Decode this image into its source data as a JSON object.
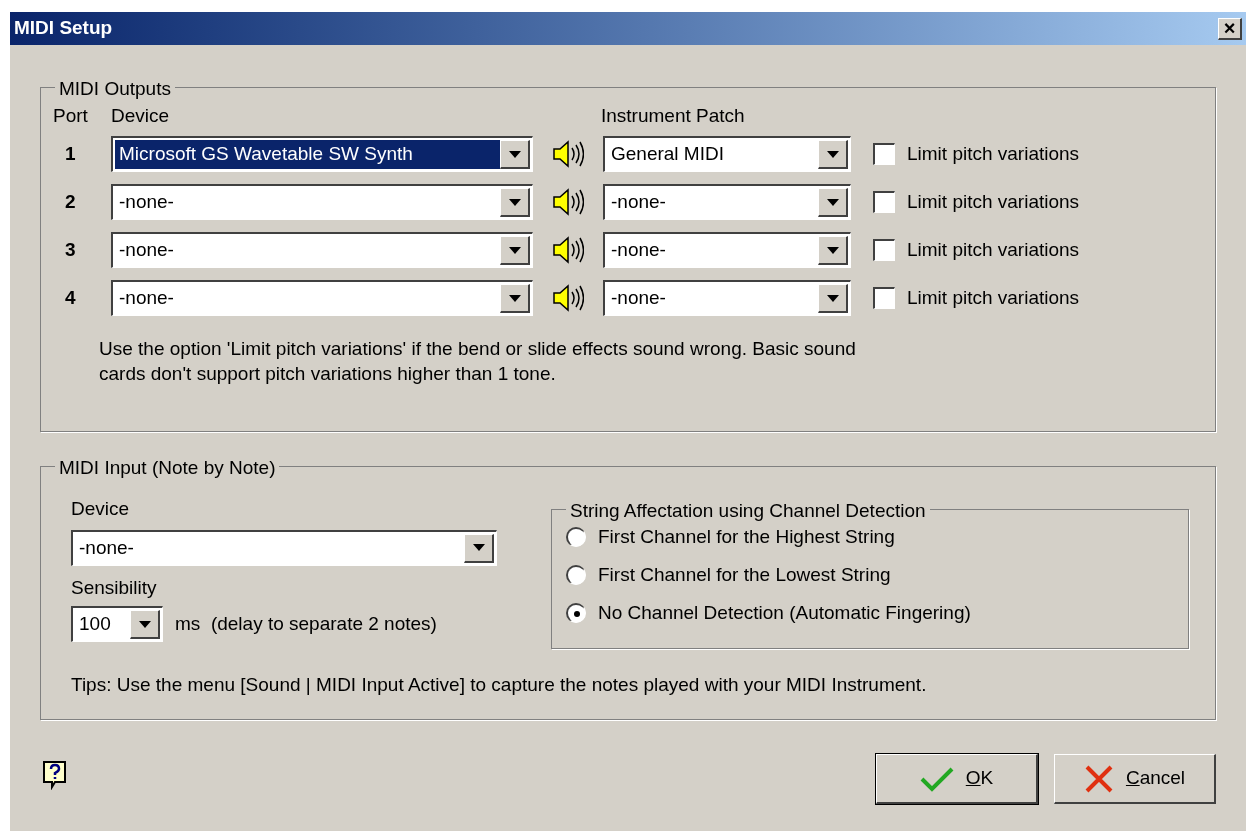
{
  "window": {
    "title": "MIDI Setup",
    "close": "×"
  },
  "outputs": {
    "legend": "MIDI Outputs",
    "headers": {
      "port": "Port",
      "device": "Device",
      "patch": "Instrument Patch"
    },
    "rows": [
      {
        "port": "1",
        "device": "Microsoft GS Wavetable SW Synth",
        "device_highlighted": true,
        "patch": "General MIDI",
        "limit_label": "Limit pitch variations",
        "limit_checked": false
      },
      {
        "port": "2",
        "device": "-none-",
        "device_highlighted": false,
        "patch": "-none-",
        "limit_label": "Limit pitch variations",
        "limit_checked": false
      },
      {
        "port": "3",
        "device": "-none-",
        "device_highlighted": false,
        "patch": "-none-",
        "limit_label": "Limit pitch variations",
        "limit_checked": false
      },
      {
        "port": "4",
        "device": "-none-",
        "device_highlighted": false,
        "patch": "-none-",
        "limit_label": "Limit pitch variations",
        "limit_checked": false
      }
    ],
    "note": "Use the option 'Limit pitch variations' if the bend or slide effects sound wrong. Basic sound cards don't support pitch variations higher than 1 tone."
  },
  "input": {
    "legend": "MIDI Input (Note by Note)",
    "device_label": "Device",
    "device": "-none-",
    "sensibility_label": "Sensibility",
    "sensibility": "100",
    "sensibility_note": "ms  (delay to separate 2 notes)",
    "strings": {
      "legend": "String Affectation using Channel Detection",
      "options": [
        {
          "label": "First Channel for the Highest String",
          "selected": false
        },
        {
          "label": "First Channel for the Lowest String",
          "selected": false
        },
        {
          "label": "No Channel Detection (Automatic Fingering)",
          "selected": true
        }
      ]
    },
    "tips": "Tips: Use the menu [Sound | MIDI Input Active] to capture the notes played with your MIDI Instrument."
  },
  "buttons": [
    {
      "kind": "ok",
      "label": "OK"
    },
    {
      "kind": "cancel",
      "label": "Cancel"
    }
  ]
}
